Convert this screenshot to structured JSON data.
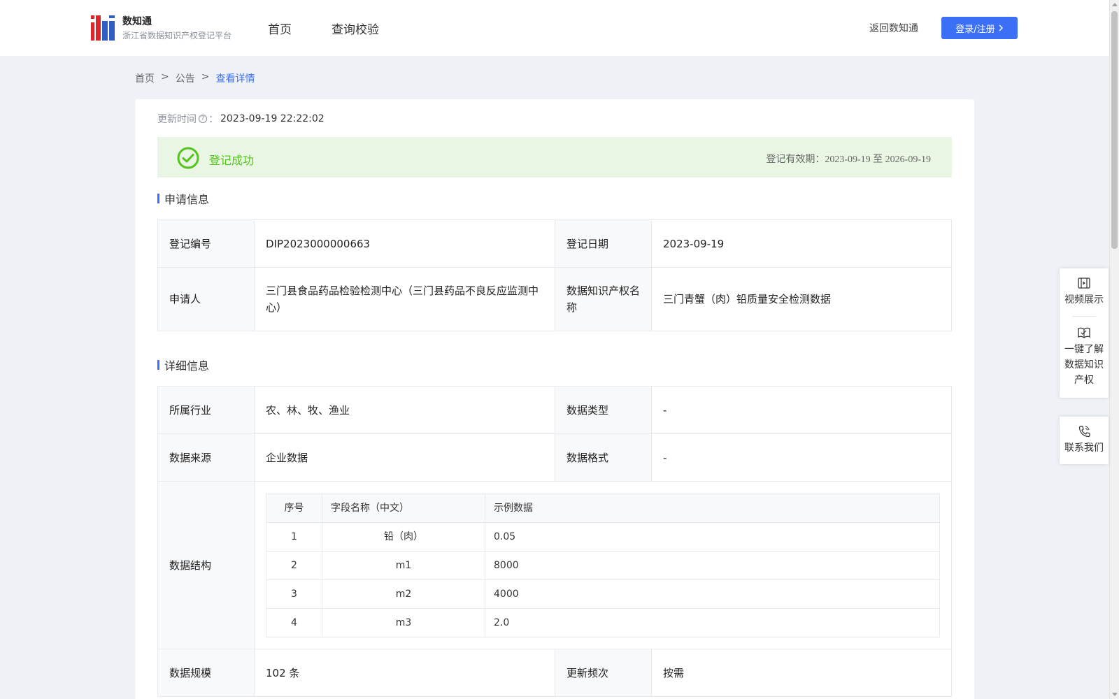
{
  "header": {
    "brand_name": "数知通",
    "brand_subtitle": "浙江省数据知识产权登记平台",
    "nav": [
      "首页",
      "查询校验"
    ],
    "back_link": "返回数知通",
    "login_label": "登录/注册",
    "accent_color": "#3b6ff5"
  },
  "breadcrumb": [
    "首页",
    ">",
    "公告",
    ">",
    "查看详情"
  ],
  "update": {
    "label": "更新时间",
    "colon": "：",
    "value": "2023-09-19 22:22:02"
  },
  "status": {
    "text": "登记成功",
    "validity_label": "登记有效期：",
    "validity_value": "2023-09-19 至 2026-09-19",
    "color": "#52c41a"
  },
  "application_section": {
    "title": "申请信息",
    "rows": [
      {
        "label1": "登记编号",
        "value1": "DIP2023000000663",
        "label2": "登记日期",
        "value2": "2023-09-19"
      },
      {
        "label1": "申请人",
        "value1": "三门县食品药品检验检测中心（三门县药品不良反应监测中心）",
        "label2": "数据知识产权名称",
        "value2": "三门青蟹（肉）铅质量安全检测数据"
      }
    ]
  },
  "detail_section": {
    "title": "详细信息",
    "rows": [
      {
        "label1": "所属行业",
        "value1": "农、林、牧、渔业",
        "label2": "数据类型",
        "value2": "-"
      },
      {
        "label1": "数据来源",
        "value1": "企业数据",
        "label2": "数据格式",
        "value2": "-"
      }
    ],
    "structure_label": "数据结构",
    "structure": {
      "headers": [
        "序号",
        "字段名称（中文）",
        "示例数据"
      ],
      "rows": [
        [
          "1",
          "铅（肉）",
          "0.05"
        ],
        [
          "2",
          "m1",
          "8000"
        ],
        [
          "3",
          "m2",
          "4000"
        ],
        [
          "4",
          "m3",
          "2.0"
        ]
      ]
    },
    "last_row": {
      "label1": "数据规模",
      "value1": "102 条",
      "label2": "更新频次",
      "value2": "按需"
    }
  },
  "side_panel": {
    "video": "视频展示",
    "learn": "一键了解数据知识产权",
    "contact": "联系我们"
  }
}
